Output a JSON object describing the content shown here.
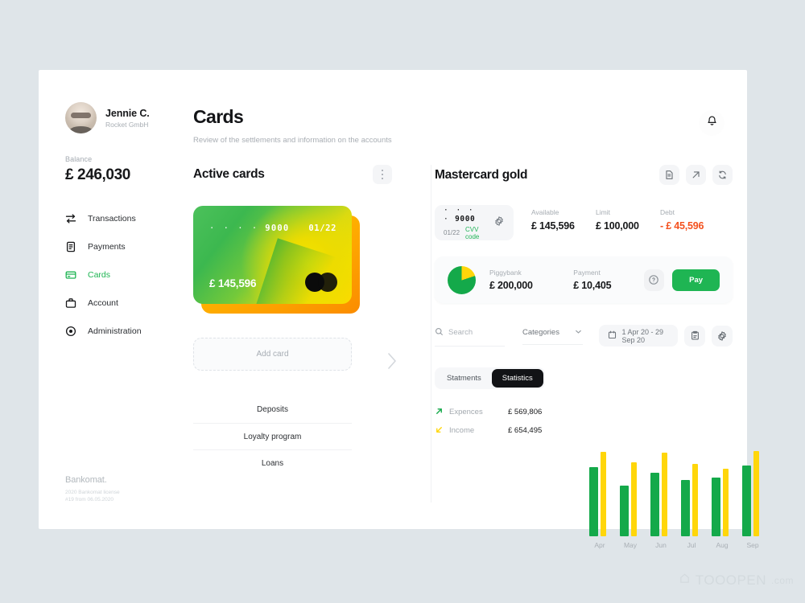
{
  "profile": {
    "name": "Jennie C.",
    "company": "Rocket GmbH",
    "avatar_icon": "user-avatar"
  },
  "balance": {
    "label": "Balance",
    "value": "£ 246,030"
  },
  "sidebar": {
    "items": [
      {
        "label": "Transactions",
        "icon": "transfer-icon",
        "active": false
      },
      {
        "label": "Payments",
        "icon": "receipt-icon",
        "active": false
      },
      {
        "label": "Cards",
        "icon": "credit-card-icon",
        "active": true
      },
      {
        "label": "Account",
        "icon": "briefcase-icon",
        "active": false
      },
      {
        "label": "Administration",
        "icon": "settings-target-icon",
        "active": false
      }
    ],
    "brand_name": "Bankomat.",
    "brand_license_line1": "2020 Bankomat license",
    "brand_license_line2": "#19 from 06.05.2020"
  },
  "header": {
    "title": "Cards",
    "subtitle": "Review of the settlements and information on the accounts",
    "bell_icon": "bell-icon"
  },
  "active_cards": {
    "title": "Active cards",
    "kebab_icon": "more-vertical-icon",
    "card": {
      "dots": "· · · ·",
      "number": "9000",
      "expiry": "01/22",
      "amount": "£ 145,596",
      "brand_icon": "mastercard-icon"
    },
    "next_icon": "chevron-right-icon",
    "expand_icon": "chevron-down-icon",
    "add_card_label": "Add card",
    "links": [
      "Deposits",
      "Loyalty program",
      "Loans"
    ]
  },
  "detail": {
    "title": "Mastercard gold",
    "icons": [
      "statement-icon",
      "share-arrow-icon",
      "refresh-icon"
    ],
    "mini_card": {
      "dots": "· · · ·",
      "number": "9000",
      "expiry": "01/22",
      "cvv_label": "CVV code",
      "gear_icon": "gear-icon"
    },
    "stats": [
      {
        "label": "Available",
        "value": "£ 145,596",
        "kind": "normal"
      },
      {
        "label": "Limit",
        "value": "£ 100,000",
        "kind": "normal"
      },
      {
        "label": "Debt",
        "value": "- £ 45,596",
        "kind": "debt"
      }
    ],
    "piggy": {
      "pie_icon": "pie-chart-icon",
      "piggybank_label": "Piggybank",
      "piggybank_value": "£ 200,000",
      "payment_label": "Payment",
      "payment_value": "£ 10,405",
      "help_icon": "help-circle-icon",
      "pay_label": "Pay"
    },
    "filters": {
      "search_placeholder": "Search",
      "search_value": "",
      "search_icon": "search-icon",
      "categories_label": "Categories",
      "chevron_icon": "chevron-down-icon",
      "date_range": "1 Apr 20 - 29 Sep 20",
      "calendar_icon": "calendar-icon",
      "export_icon": "export-icon",
      "settings_icon": "gear-icon"
    },
    "tabs": [
      {
        "label": "Statments",
        "active": false
      },
      {
        "label": "Statistics",
        "active": true
      }
    ],
    "legend": [
      {
        "name": "Expences",
        "value": "£ 569,806",
        "color": "#14a94a",
        "arrow": "arrow-up-right-icon"
      },
      {
        "name": "Income",
        "value": "£ 654,495",
        "color": "#ffd60a",
        "arrow": "arrow-down-left-icon"
      }
    ]
  },
  "chart_data": {
    "type": "bar",
    "title": "",
    "categories": [
      "Apr",
      "May",
      "Jun",
      "Jul",
      "Aug",
      "Sep"
    ],
    "series": [
      {
        "name": "Expences",
        "color": "#14a94a",
        "values": [
          86,
          63,
          79,
          70,
          73,
          88
        ]
      },
      {
        "name": "Income",
        "color": "#ffd60a",
        "values": [
          105,
          92,
          104,
          90,
          84,
          106
        ]
      }
    ],
    "ylim": [
      0,
      110
    ],
    "grid": false,
    "legend_position": "left",
    "xlabel": "",
    "ylabel": ""
  },
  "watermark": {
    "text": "TOOOPEN",
    "suffix": ".com"
  },
  "colors": {
    "accent_green": "#1fb553",
    "accent_yellow": "#ffd60a",
    "debt_orange": "#f4511e",
    "background": "#dfe5e9",
    "panel": "#ffffff"
  }
}
